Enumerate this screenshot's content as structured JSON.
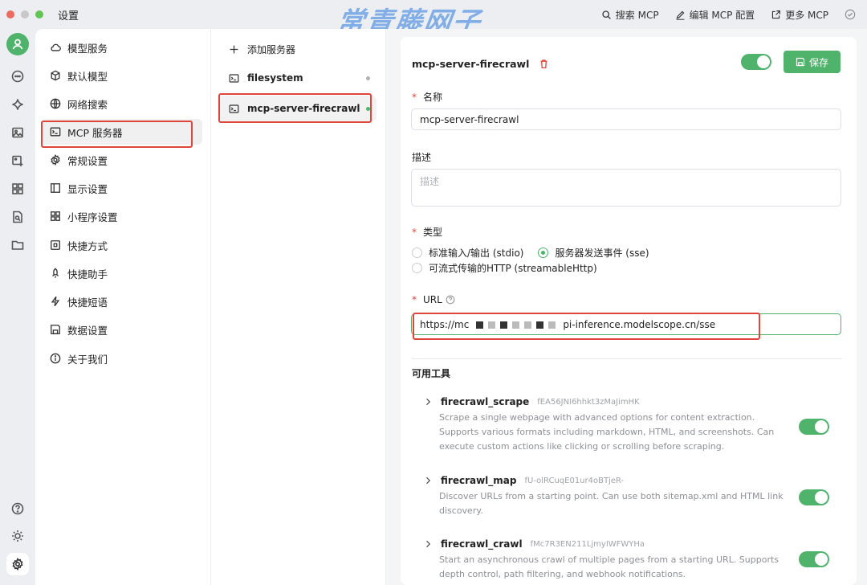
{
  "window": {
    "title": "设置"
  },
  "watermark": "常青藤网子",
  "toolbar": {
    "search_mcp": "搜索 MCP",
    "edit_mcp_config": "编辑 MCP 配置",
    "more_mcp": "更多 MCP"
  },
  "menu": {
    "items": [
      {
        "label": "模型服务",
        "icon": "cloud-icon"
      },
      {
        "label": "默认模型",
        "icon": "cube-icon"
      },
      {
        "label": "网络搜索",
        "icon": "globe-icon"
      },
      {
        "label": "MCP 服务器",
        "icon": "terminal-icon"
      },
      {
        "label": "常规设置",
        "icon": "gear-icon"
      },
      {
        "label": "显示设置",
        "icon": "layout-icon"
      },
      {
        "label": "小程序设置",
        "icon": "grid-icon"
      },
      {
        "label": "快捷方式",
        "icon": "command-icon"
      },
      {
        "label": "快捷助手",
        "icon": "rocket-icon"
      },
      {
        "label": "快捷短语",
        "icon": "bolt-icon"
      },
      {
        "label": "数据设置",
        "icon": "save-icon"
      },
      {
        "label": "关于我们",
        "icon": "info-icon"
      }
    ],
    "active_index": 3
  },
  "servers": {
    "add_label": "添加服务器",
    "items": [
      {
        "name": "filesystem",
        "active": false
      },
      {
        "name": "mcp-server-firecrawl",
        "active": true
      }
    ]
  },
  "detail": {
    "title": "mcp-server-firecrawl",
    "enabled": true,
    "save_label": "保存",
    "name_label": "名称",
    "name_value": "mcp-server-firecrawl",
    "desc_label": "描述",
    "desc_placeholder": "描述",
    "type_label": "类型",
    "type_options": [
      {
        "label": "标准输入/输出 (stdio)",
        "checked": false
      },
      {
        "label": "服务器发送事件 (sse)",
        "checked": true
      },
      {
        "label": "可流式传输的HTTP (streamableHttp)",
        "checked": false
      }
    ],
    "url_label": "URL",
    "url_prefix": "https://mc",
    "url_suffix": "pi-inference.modelscope.cn/sse",
    "tools_title": "可用工具",
    "tools": [
      {
        "name": "firecrawl_scrape",
        "id": "fEA56JNI6hhkt3zMaJimHK",
        "desc": "Scrape a single webpage with advanced options for content extraction. Supports various formats including markdown, HTML, and screenshots. Can execute custom actions like clicking or scrolling before scraping.",
        "enabled": true
      },
      {
        "name": "firecrawl_map",
        "id": "fU-olRCuqE01ur4oBTjeR-",
        "desc": "Discover URLs from a starting point. Can use both sitemap.xml and HTML link discovery.",
        "enabled": true
      },
      {
        "name": "firecrawl_crawl",
        "id": "fMc7R3EN211LjmyIWFWYHa",
        "desc": "Start an asynchronous crawl of multiple pages from a starting URL. Supports depth control, path filtering, and webhook notifications.",
        "enabled": true
      }
    ]
  },
  "colors": {
    "accent": "#4fb36b",
    "highlight": "#e0453a"
  }
}
